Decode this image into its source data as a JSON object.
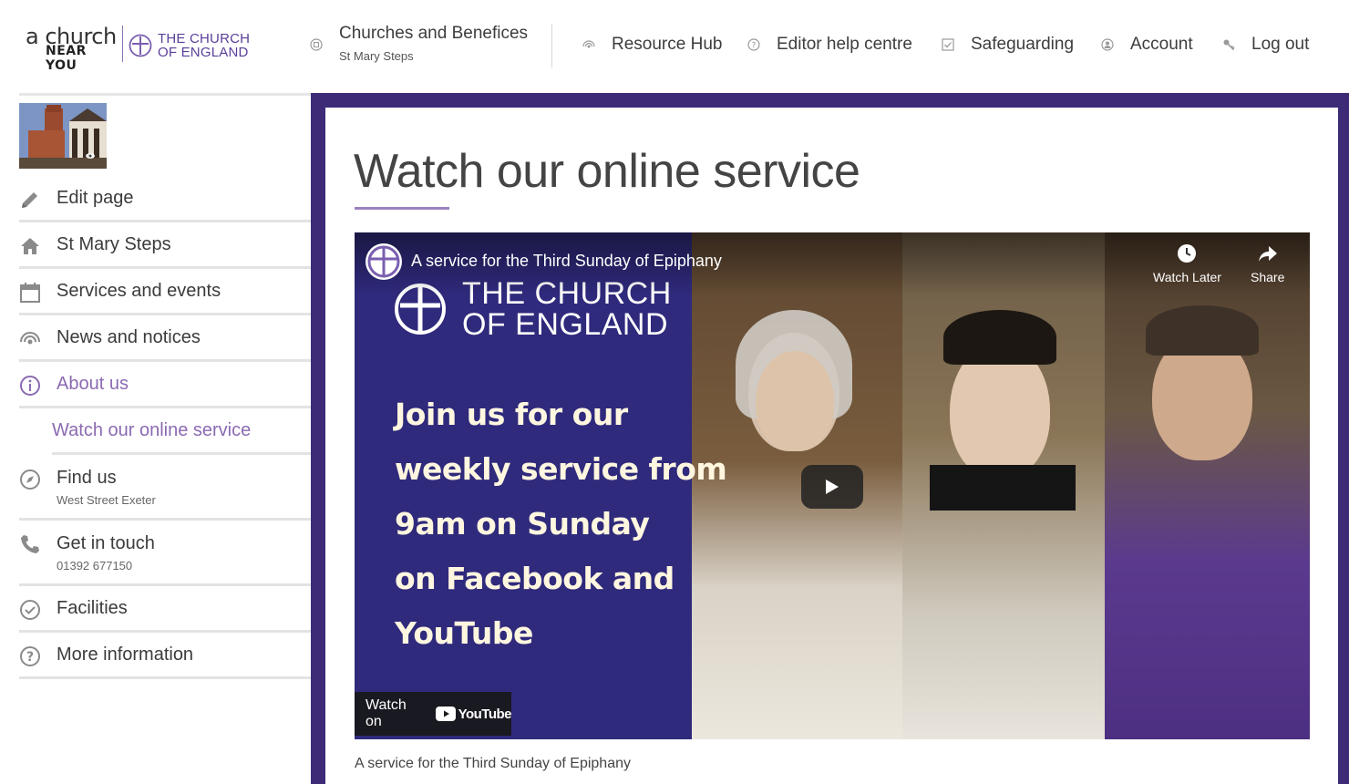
{
  "header": {
    "logo_line1": "a church",
    "logo_line2": "NEAR YOU",
    "coe_line1": "THE CHURCH",
    "coe_line2": "OF ENGLAND",
    "churches_label": "Churches and Benefices",
    "churches_sub": "St Mary Steps",
    "nav": [
      {
        "label": "Resource Hub",
        "icon": "broadcast-icon"
      },
      {
        "label": "Editor help centre",
        "icon": "question-icon"
      },
      {
        "label": "Safeguarding",
        "icon": "check-box-icon"
      },
      {
        "label": "Account",
        "icon": "account-icon"
      },
      {
        "label": "Log out",
        "icon": "key-icon"
      }
    ]
  },
  "sidebar": {
    "items": [
      {
        "label": "Edit page",
        "icon": "pencil-icon"
      },
      {
        "label": "St Mary Steps",
        "icon": "home-icon"
      },
      {
        "label": "Services and events",
        "icon": "calendar-icon"
      },
      {
        "label": "News and notices",
        "icon": "broadcast-icon"
      },
      {
        "label": "About us",
        "icon": "info-icon"
      },
      {
        "label": "Watch our online service"
      },
      {
        "label": "Find us",
        "sub": "West Street Exeter",
        "icon": "compass-icon"
      },
      {
        "label": "Get in touch",
        "sub": "01392 677150",
        "icon": "phone-icon"
      },
      {
        "label": "Facilities",
        "icon": "check-circle-icon"
      },
      {
        "label": "More information",
        "icon": "question-icon"
      }
    ]
  },
  "main": {
    "title": "Watch our online service",
    "video": {
      "title": "A service for the Third Sunday of Epiphany",
      "coe_line1": "THE CHURCH",
      "coe_line2": "OF ENGLAND",
      "promo": [
        "Join us for our",
        "weekly service from",
        "9am on Sunday",
        "on Facebook and",
        "YouTube"
      ],
      "watch_later": "Watch Later",
      "share": "Share",
      "watch_on": "Watch on",
      "youtube": "YouTube"
    },
    "caption": "A service for the Third Sunday of Epiphany"
  },
  "colors": {
    "accent": "#8b6ab2",
    "frame": "#3d2b78",
    "promo_bg": "#2f2a7c"
  }
}
